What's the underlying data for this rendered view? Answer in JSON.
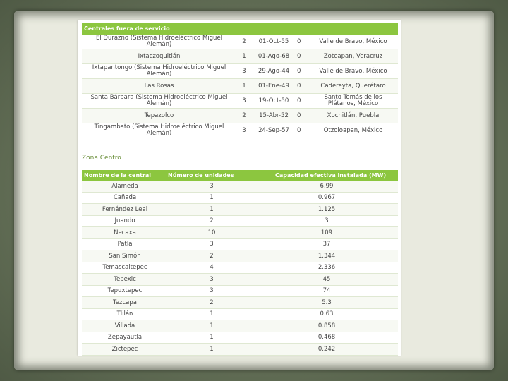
{
  "out_of_service": {
    "header": "Centrales fuera de servicio",
    "rows": [
      [
        "El Durazno (Sistema Hidroeléctrico Miguel Alemán)",
        "2",
        "01-Oct-55",
        "0",
        "Valle de Bravo, México"
      ],
      [
        "Ixtaczoquitlán",
        "1",
        "01-Ago-68",
        "0",
        "Zoteapan, Veracruz"
      ],
      [
        "Ixtapantongo (Sistema Hidroeléctrico Miguel Alemán)",
        "3",
        "29-Ago-44",
        "0",
        "Valle de Bravo, México"
      ],
      [
        "Las Rosas",
        "1",
        "01-Ene-49",
        "0",
        "Cadereyta, Querétaro"
      ],
      [
        "Santa Bárbara (Sistema Hidroeléctrico Miguel Alemán)",
        "3",
        "19-Oct-50",
        "0",
        "Santo Tomás de los Plátanos, México"
      ],
      [
        "Tepazolco",
        "2",
        "15-Abr-52",
        "0",
        "Xochitlán, Puebla"
      ],
      [
        "Tingambato (Sistema Hidroeléctrico Miguel Alemán)",
        "3",
        "24-Sep-57",
        "0",
        "Otzoloapan, México"
      ]
    ]
  },
  "zone_title": "Zona Centro",
  "centro": {
    "headers": [
      "Nombre de la central",
      "Número de unidades",
      "Capacidad efectiva instalada (MW)"
    ],
    "rows": [
      [
        "Alameda",
        "3",
        "6.99"
      ],
      [
        "Cañada",
        "1",
        "0.967"
      ],
      [
        "Fernández Leal",
        "1",
        "1.125"
      ],
      [
        "Juando",
        "2",
        "3"
      ],
      [
        "Necaxa",
        "10",
        "109"
      ],
      [
        "Patla",
        "3",
        "37"
      ],
      [
        "San Simón",
        "2",
        "1.344"
      ],
      [
        "Temascaltepec",
        "4",
        "2.336"
      ],
      [
        "Tepexic",
        "3",
        "45"
      ],
      [
        "Tepuxtepec",
        "3",
        "74"
      ],
      [
        "Tezcapa",
        "2",
        "5.3"
      ],
      [
        "Tlilán",
        "1",
        "0.63"
      ],
      [
        "Villada",
        "1",
        "0.858"
      ],
      [
        "Zepayautla",
        "1",
        "0.468"
      ],
      [
        "Zictepec",
        "1",
        "0.242"
      ]
    ]
  }
}
